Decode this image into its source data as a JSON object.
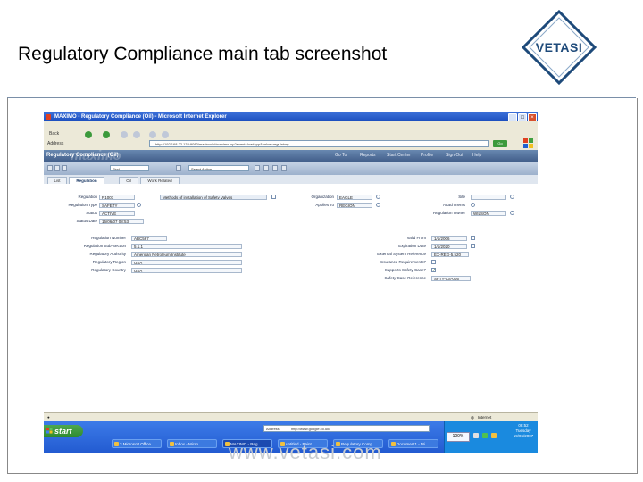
{
  "slide": {
    "title": "Regulatory Compliance main tab screenshot",
    "logo_text": "VETASI",
    "watermark": "www.vetasi.com"
  },
  "colors": {
    "brand": "#1e4a7a",
    "xp_title": "#1c4fbf",
    "maximo_header": "#405c88",
    "taskbar": "#225ad0",
    "start": "#2e8a2e"
  },
  "browser": {
    "title": "MAXIMO - Regulatory Compliance (Oil) - Microsoft Internet Explorer",
    "back_label": "Back",
    "search_label": "",
    "address_label": "Address",
    "address": "http://192.168.22.133:9080/maximo/ui/maximo.jsp?event=loadapp&value=regulatory",
    "go_label": "Go",
    "status_text": "",
    "status_zone": "Internet"
  },
  "maximo": {
    "app_title": "Regulatory Compliance (Oil)",
    "brand_watermark": "maximo",
    "nav": [
      "Go To",
      "Reports",
      "Start Center",
      "Profile",
      "Sign Out",
      "Help"
    ],
    "find_label": "Find",
    "select_action": "Select Action",
    "tabs": [
      "List",
      "Regulation",
      "Oil",
      "Work Related"
    ],
    "active_tab": 1
  },
  "form_top": {
    "left": [
      {
        "label": "Regulation",
        "value": "R1001"
      },
      {
        "label": "Regulation Type",
        "value": "SAFETY"
      },
      {
        "label": "Status",
        "value": "ACTIVE"
      },
      {
        "label": "Status Date",
        "value": "16/06/07 08:53"
      }
    ],
    "description": "Methods of installation of Safety Valves",
    "middle": [
      {
        "label": "Organization",
        "value": "EAGLE"
      },
      {
        "label": "Applies To",
        "value": "REGION"
      }
    ],
    "right": [
      {
        "label": "Site",
        "value": ""
      },
      {
        "label": "Attachments",
        "value": ""
      },
      {
        "label": "Regulation Owner",
        "value": "WILSON"
      }
    ]
  },
  "form_details": {
    "left": [
      {
        "label": "Regulation Number",
        "value": "ABC567"
      },
      {
        "label": "Regulation Sub-Section",
        "value": "5.1.1"
      },
      {
        "label": "Regulatory Authority",
        "value": "American Petroleum Institute"
      },
      {
        "label": "Regulatory Region",
        "value": "USA"
      },
      {
        "label": "Regulatory Country",
        "value": "USA"
      }
    ],
    "right": [
      {
        "label": "Valid From",
        "value": "1/1/2006"
      },
      {
        "label": "Expiration Date",
        "value": "1/1/2020"
      },
      {
        "label": "External System Reference",
        "value": "EX-REG-5.520"
      },
      {
        "label": "Insurance Requirements?",
        "value": ""
      },
      {
        "label": "Supports Safety Case?",
        "value": "✓"
      },
      {
        "label": "Safety Case Reference",
        "value": "SFTY-CS-005"
      }
    ]
  },
  "taskbar": {
    "start_label": "start",
    "items": [
      "3 Microsoft Office...",
      "Inbox - Micro...",
      "MAXIMO - Reg...",
      "untitled - Paint",
      "Regulatory Comp...",
      "Document1 - Mi..."
    ],
    "active_item": 2,
    "quick_address_label": "Address",
    "quick_address": "http://www.google.co.uk/",
    "zoom": "100%",
    "clock_lines": [
      "08:52",
      "Tuesday",
      "19/06/2007"
    ]
  }
}
